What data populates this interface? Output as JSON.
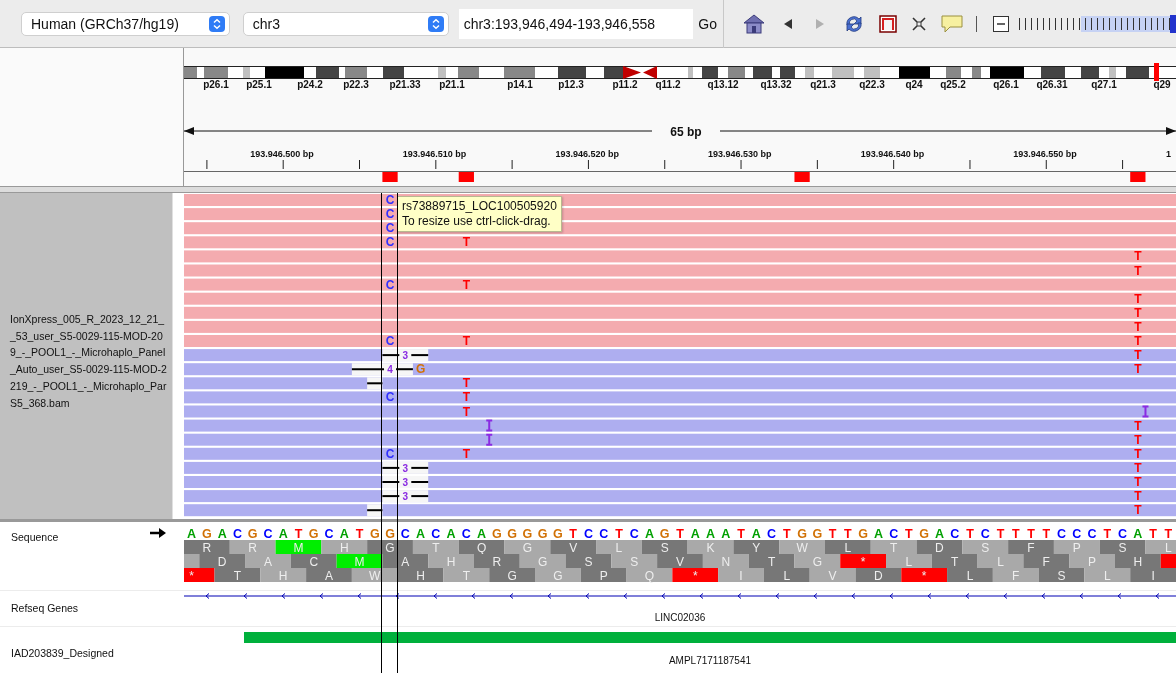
{
  "toolbar": {
    "genome": "Human (GRCh37/hg19)",
    "chromosome": "chr3",
    "locus": "chr3:193,946,494-193,946,558",
    "go_button": "Go",
    "nav": [
      {
        "kind": "back",
        "disabled": false
      },
      {
        "kind": "forward",
        "disabled": true
      }
    ],
    "zoom": {
      "level": 0.98
    }
  },
  "ideogram": {
    "band_labels": [
      "p26.1",
      "p25.1",
      "p24.2",
      "p22.3",
      "p21.33",
      "p21.1",
      "p14.1",
      "p12.3",
      "p11.2",
      "q11.2",
      "q13.12",
      "q13.32",
      "q21.3",
      "q22.3",
      "q24",
      "q25.2",
      "q26.1",
      "q26.31",
      "q27.1",
      "q29"
    ]
  },
  "ruler": {
    "span": "65 bp",
    "tick_labels": [
      "193.946.500 bp",
      "193.946.510 bp",
      "193.946.520 bp",
      "193.946.530 bp",
      "193.946.540 bp",
      "193.946.550 bp",
      "1"
    ]
  },
  "tooltip": {
    "title": "rs73889715_LOC100505920",
    "hint": "To resize use ctrl-click-drag."
  },
  "alignment_track": {
    "name_lines": [
      "IonXpress_005_R_2023_12_21_",
      "_53_user_S5-0029-115-MOD-20",
      "9_-_POOL1_-_Microhaplo_Panel",
      "_Auto_user_S5-0029-115-MOD-2",
      "219_-_POOL1_-_Microhaplo_Par",
      "S5_368.bam"
    ],
    "reads": [
      {
        "reverse": false
      },
      {
        "reverse": false
      },
      {
        "reverse": false
      },
      {
        "reverse": false
      },
      {
        "reverse": false
      },
      {
        "reverse": false
      },
      {
        "reverse": false
      },
      {
        "reverse": false
      },
      {
        "reverse": false
      },
      {
        "reverse": false
      },
      {
        "reverse": false
      },
      {
        "reverse": true
      },
      {
        "reverse": true
      },
      {
        "reverse": true
      },
      {
        "reverse": true
      },
      {
        "reverse": true
      },
      {
        "reverse": true
      },
      {
        "reverse": true
      },
      {
        "reverse": true
      },
      {
        "reverse": true
      },
      {
        "reverse": true
      },
      {
        "reverse": true
      },
      {
        "reverse": true
      }
    ]
  },
  "sequence_track": {
    "name": "Sequence",
    "bases": [
      {
        "base": "A"
      },
      {
        "base": "G"
      },
      {
        "base": "A"
      },
      {
        "base": "C"
      },
      {
        "base": "G"
      },
      {
        "base": "C"
      },
      {
        "base": "A"
      },
      {
        "base": "T"
      },
      {
        "base": "G"
      },
      {
        "base": "C"
      },
      {
        "base": "A"
      },
      {
        "base": "T",
        "calls": [
          {
            "kind": "match"
          },
          {
            "kind": "match"
          },
          {
            "kind": "match"
          },
          {
            "kind": "match"
          },
          {
            "kind": "match"
          },
          {
            "kind": "match"
          },
          {
            "kind": "match"
          },
          {
            "kind": "match"
          },
          {
            "kind": "match"
          },
          {
            "kind": "match"
          },
          {
            "kind": "match"
          },
          {
            "kind": "match"
          },
          {
            "kind": "deletion"
          },
          {
            "kind": "match"
          },
          {
            "kind": "match"
          },
          {
            "kind": "match"
          },
          {
            "kind": "match"
          },
          {
            "kind": "match"
          },
          {
            "kind": "match"
          },
          {
            "kind": "match"
          },
          {
            "kind": "match"
          },
          {
            "kind": "match"
          },
          {
            "kind": "match"
          }
        ]
      },
      {
        "base": "G",
        "calls": [
          {
            "kind": "match"
          },
          {
            "kind": "match"
          },
          {
            "kind": "match"
          },
          {
            "kind": "match"
          },
          {
            "kind": "match"
          },
          {
            "kind": "match"
          },
          {
            "kind": "match"
          },
          {
            "kind": "match"
          },
          {
            "kind": "match"
          },
          {
            "kind": "match"
          },
          {
            "kind": "match"
          },
          {
            "kind": "match"
          },
          {
            "kind": "deletion"
          },
          {
            "kind": "deletion"
          },
          {
            "kind": "match"
          },
          {
            "kind": "match"
          },
          {
            "kind": "match"
          },
          {
            "kind": "match"
          },
          {
            "kind": "match"
          },
          {
            "kind": "match"
          },
          {
            "kind": "match"
          },
          {
            "kind": "match"
          },
          {
            "kind": "deletion"
          }
        ]
      },
      {
        "base": "G",
        "calls": [
          {
            "kind": "mismatch",
            "base": "C"
          },
          {
            "kind": "mismatch",
            "base": "C"
          },
          {
            "kind": "mismatch",
            "base": "C"
          },
          {
            "kind": "mismatch",
            "base": "C"
          },
          {
            "kind": "match"
          },
          {
            "kind": "match"
          },
          {
            "kind": "mismatch",
            "base": "C"
          },
          {
            "kind": "match"
          },
          {
            "kind": "match"
          },
          {
            "kind": "match"
          },
          {
            "kind": "mismatch",
            "base": "C"
          },
          {
            "kind": "deletion"
          },
          {
            "kind": "deletion",
            "label": "4"
          },
          {
            "kind": "match"
          },
          {
            "kind": "mismatch",
            "base": "C"
          },
          {
            "kind": "match"
          },
          {
            "kind": "match"
          },
          {
            "kind": "match"
          },
          {
            "kind": "mismatch",
            "base": "C"
          },
          {
            "kind": "deletion"
          },
          {
            "kind": "deletion"
          },
          {
            "kind": "deletion"
          },
          {
            "kind": "match"
          }
        ]
      },
      {
        "base": "C",
        "calls": [
          {
            "kind": "match"
          },
          {
            "kind": "match"
          },
          {
            "kind": "match"
          },
          {
            "kind": "match"
          },
          {
            "kind": "match"
          },
          {
            "kind": "match"
          },
          {
            "kind": "match"
          },
          {
            "kind": "match"
          },
          {
            "kind": "match"
          },
          {
            "kind": "match"
          },
          {
            "kind": "match"
          },
          {
            "kind": "deletion",
            "label": "3"
          },
          {
            "kind": "deletion"
          },
          {
            "kind": "match"
          },
          {
            "kind": "match"
          },
          {
            "kind": "match"
          },
          {
            "kind": "match"
          },
          {
            "kind": "match"
          },
          {
            "kind": "match"
          },
          {
            "kind": "deletion",
            "label": "3"
          },
          {
            "kind": "deletion",
            "label": "3"
          },
          {
            "kind": "deletion",
            "label": "3"
          },
          {
            "kind": "match"
          }
        ]
      },
      {
        "base": "A",
        "calls": [
          {
            "kind": "match"
          },
          {
            "kind": "match"
          },
          {
            "kind": "match"
          },
          {
            "kind": "match"
          },
          {
            "kind": "match"
          },
          {
            "kind": "match"
          },
          {
            "kind": "match"
          },
          {
            "kind": "match"
          },
          {
            "kind": "match"
          },
          {
            "kind": "match"
          },
          {
            "kind": "match"
          },
          {
            "kind": "deletion"
          },
          {
            "kind": "mismatch",
            "base": "G"
          },
          {
            "kind": "match"
          },
          {
            "kind": "match"
          },
          {
            "kind": "match"
          },
          {
            "kind": "match"
          },
          {
            "kind": "match"
          },
          {
            "kind": "match"
          },
          {
            "kind": "deletion"
          },
          {
            "kind": "deletion"
          },
          {
            "kind": "deletion"
          },
          {
            "kind": "match"
          }
        ]
      },
      {
        "base": "C"
      },
      {
        "base": "A"
      },
      {
        "base": "C",
        "calls": [
          {
            "kind": "match"
          },
          {
            "kind": "match"
          },
          {
            "kind": "match"
          },
          {
            "kind": "mismatch",
            "base": "T"
          },
          {
            "kind": "match"
          },
          {
            "kind": "match"
          },
          {
            "kind": "mismatch",
            "base": "T"
          },
          {
            "kind": "match"
          },
          {
            "kind": "match"
          },
          {
            "kind": "match"
          },
          {
            "kind": "mismatch",
            "base": "T"
          },
          {
            "kind": "match"
          },
          {
            "kind": "match"
          },
          {
            "kind": "mismatch",
            "base": "T"
          },
          {
            "kind": "mismatch",
            "base": "T"
          },
          {
            "kind": "mismatch",
            "base": "T"
          },
          {
            "kind": "match"
          },
          {
            "kind": "match"
          },
          {
            "kind": "mismatch",
            "base": "T"
          },
          {
            "kind": "match"
          },
          {
            "kind": "match"
          },
          {
            "kind": "match"
          },
          {
            "kind": "match"
          }
        ]
      },
      {
        "base": "A",
        "calls": [
          {
            "kind": "match"
          },
          {
            "kind": "match"
          },
          {
            "kind": "match"
          },
          {
            "kind": "match"
          },
          {
            "kind": "match"
          },
          {
            "kind": "match"
          },
          {
            "kind": "match"
          },
          {
            "kind": "match"
          },
          {
            "kind": "match"
          },
          {
            "kind": "match"
          },
          {
            "kind": "match"
          },
          {
            "kind": "match"
          },
          {
            "kind": "match"
          },
          {
            "kind": "match"
          },
          {
            "kind": "match"
          },
          {
            "kind": "match"
          },
          {
            "kind": "insertion"
          },
          {
            "kind": "insertion"
          },
          {
            "kind": "match"
          },
          {
            "kind": "match"
          },
          {
            "kind": "match"
          },
          {
            "kind": "match"
          },
          {
            "kind": "match"
          }
        ]
      },
      {
        "base": "G"
      },
      {
        "base": "G"
      },
      {
        "base": "G"
      },
      {
        "base": "G"
      },
      {
        "base": "G"
      },
      {
        "base": "T"
      },
      {
        "base": "C"
      },
      {
        "base": "C"
      },
      {
        "base": "T"
      },
      {
        "base": "C"
      },
      {
        "base": "A"
      },
      {
        "base": "G"
      },
      {
        "base": "T"
      },
      {
        "base": "A"
      },
      {
        "base": "A"
      },
      {
        "base": "A"
      },
      {
        "base": "T"
      },
      {
        "base": "A"
      },
      {
        "base": "C"
      },
      {
        "base": "T"
      },
      {
        "base": "G"
      },
      {
        "base": "G"
      },
      {
        "base": "T"
      },
      {
        "base": "T"
      },
      {
        "base": "G"
      },
      {
        "base": "A"
      },
      {
        "base": "C"
      },
      {
        "base": "T"
      },
      {
        "base": "G"
      },
      {
        "base": "A"
      },
      {
        "base": "C"
      },
      {
        "base": "T"
      },
      {
        "base": "C"
      },
      {
        "base": "T"
      },
      {
        "base": "T"
      },
      {
        "base": "T"
      },
      {
        "base": "T"
      },
      {
        "base": "C"
      },
      {
        "base": "C"
      },
      {
        "base": "C"
      },
      {
        "base": "T"
      },
      {
        "base": "C"
      },
      {
        "base": "A",
        "calls": [
          {
            "kind": "match"
          },
          {
            "kind": "match"
          },
          {
            "kind": "match"
          },
          {
            "kind": "match"
          },
          {
            "kind": "mismatch",
            "base": "T"
          },
          {
            "kind": "mismatch",
            "base": "T"
          },
          {
            "kind": "match"
          },
          {
            "kind": "mismatch",
            "base": "T"
          },
          {
            "kind": "mismatch",
            "base": "T"
          },
          {
            "kind": "mismatch",
            "base": "T"
          },
          {
            "kind": "mismatch",
            "base": "T"
          },
          {
            "kind": "mismatch",
            "base": "T"
          },
          {
            "kind": "mismatch",
            "base": "T"
          },
          {
            "kind": "match"
          },
          {
            "kind": "match"
          },
          {
            "kind": "insertion"
          },
          {
            "kind": "mismatch",
            "base": "T"
          },
          {
            "kind": "mismatch",
            "base": "T"
          },
          {
            "kind": "mismatch",
            "base": "T"
          },
          {
            "kind": "mismatch",
            "base": "T"
          },
          {
            "kind": "mismatch",
            "base": "T"
          },
          {
            "kind": "mismatch",
            "base": "T"
          },
          {
            "kind": "mismatch",
            "base": "T"
          }
        ]
      },
      {
        "base": "T"
      },
      {
        "base": "T"
      }
    ],
    "frames": [
      {
        "codons": [
          {
            "aa": "R",
            "kind": "amino"
          },
          {
            "aa": "R",
            "kind": "amino"
          },
          {
            "aa": "M",
            "kind": "start"
          },
          {
            "aa": "H",
            "kind": "amino"
          },
          {
            "aa": "G",
            "kind": "amino"
          },
          {
            "aa": "T",
            "kind": "amino"
          },
          {
            "aa": "Q",
            "kind": "amino"
          },
          {
            "aa": "G",
            "kind": "amino"
          },
          {
            "aa": "V",
            "kind": "amino"
          },
          {
            "aa": "L",
            "kind": "amino"
          },
          {
            "aa": "S",
            "kind": "amino"
          },
          {
            "aa": "K",
            "kind": "amino"
          },
          {
            "aa": "Y",
            "kind": "amino"
          },
          {
            "aa": "W",
            "kind": "amino"
          },
          {
            "aa": "L",
            "kind": "amino"
          },
          {
            "aa": "T",
            "kind": "amino"
          },
          {
            "aa": "D",
            "kind": "amino"
          },
          {
            "aa": "S",
            "kind": "amino"
          },
          {
            "aa": "F",
            "kind": "amino"
          },
          {
            "aa": "P",
            "kind": "amino"
          },
          {
            "aa": "S",
            "kind": "amino"
          },
          {
            "aa": "L",
            "kind": "amino"
          }
        ]
      },
      {
        "codons": [
          {
            "kind": "amino"
          },
          {
            "aa": "D",
            "kind": "amino"
          },
          {
            "aa": "A",
            "kind": "amino"
          },
          {
            "aa": "C",
            "kind": "amino"
          },
          {
            "aa": "M",
            "kind": "start"
          },
          {
            "aa": "A",
            "kind": "amino"
          },
          {
            "aa": "H",
            "kind": "amino"
          },
          {
            "aa": "R",
            "kind": "amino"
          },
          {
            "aa": "G",
            "kind": "amino"
          },
          {
            "aa": "S",
            "kind": "amino"
          },
          {
            "aa": "S",
            "kind": "amino"
          },
          {
            "aa": "V",
            "kind": "amino"
          },
          {
            "aa": "N",
            "kind": "amino"
          },
          {
            "aa": "T",
            "kind": "amino"
          },
          {
            "aa": "G",
            "kind": "amino"
          },
          {
            "aa": "*",
            "kind": "stop"
          },
          {
            "aa": "L",
            "kind": "amino"
          },
          {
            "aa": "T",
            "kind": "amino"
          },
          {
            "aa": "L",
            "kind": "amino"
          },
          {
            "aa": "F",
            "kind": "amino"
          },
          {
            "aa": "P",
            "kind": "amino"
          },
          {
            "aa": "H",
            "kind": "amino"
          },
          {
            "kind": "stop"
          }
        ]
      },
      {
        "codons": [
          {
            "aa": "*",
            "kind": "stop"
          },
          {
            "aa": "T",
            "kind": "amino"
          },
          {
            "aa": "H",
            "kind": "amino"
          },
          {
            "aa": "A",
            "kind": "amino"
          },
          {
            "aa": "W",
            "kind": "amino"
          },
          {
            "aa": "H",
            "kind": "amino"
          },
          {
            "aa": "T",
            "kind": "amino"
          },
          {
            "aa": "G",
            "kind": "amino"
          },
          {
            "aa": "G",
            "kind": "amino"
          },
          {
            "aa": "P",
            "kind": "amino"
          },
          {
            "aa": "Q",
            "kind": "amino"
          },
          {
            "aa": "*",
            "kind": "stop"
          },
          {
            "aa": "I",
            "kind": "amino"
          },
          {
            "aa": "L",
            "kind": "amino"
          },
          {
            "aa": "V",
            "kind": "amino"
          },
          {
            "aa": "D",
            "kind": "amino"
          },
          {
            "aa": "*",
            "kind": "stop"
          },
          {
            "aa": "L",
            "kind": "amino"
          },
          {
            "aa": "F",
            "kind": "amino"
          },
          {
            "aa": "S",
            "kind": "amino"
          },
          {
            "aa": "L",
            "kind": "amino"
          },
          {
            "aa": "I",
            "kind": "amino"
          }
        ]
      }
    ]
  },
  "feature_tracks": [
    {
      "name": "Refseq Genes",
      "kind": "gene",
      "feature": "LINC02036"
    },
    {
      "name": "IAD203839_Designed",
      "kind": "region",
      "feature": "AMPL7171187541"
    }
  ]
}
